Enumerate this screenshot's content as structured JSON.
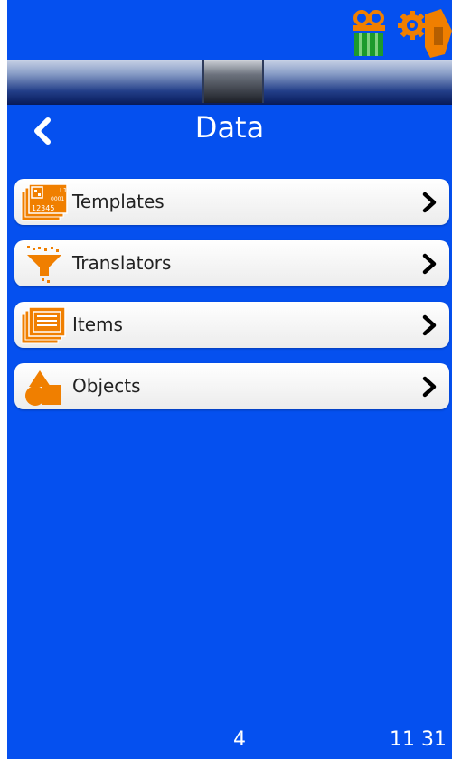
{
  "header": {
    "title": "Data"
  },
  "menu": {
    "items": [
      {
        "label": "Templates",
        "icon": "template-icon"
      },
      {
        "label": "Translators",
        "icon": "funnel-icon"
      },
      {
        "label": "Items",
        "icon": "list-icon"
      },
      {
        "label": "Objects",
        "icon": "shapes-icon"
      }
    ],
    "template_icon_text": {
      "line1": "L1",
      "line2": "0001",
      "line3": "12345"
    }
  },
  "footer": {
    "page": "4",
    "time": "11 31"
  },
  "colors": {
    "background": "#0550ef",
    "accent": "#f07f00",
    "item_bg": "#f0f0f0"
  }
}
